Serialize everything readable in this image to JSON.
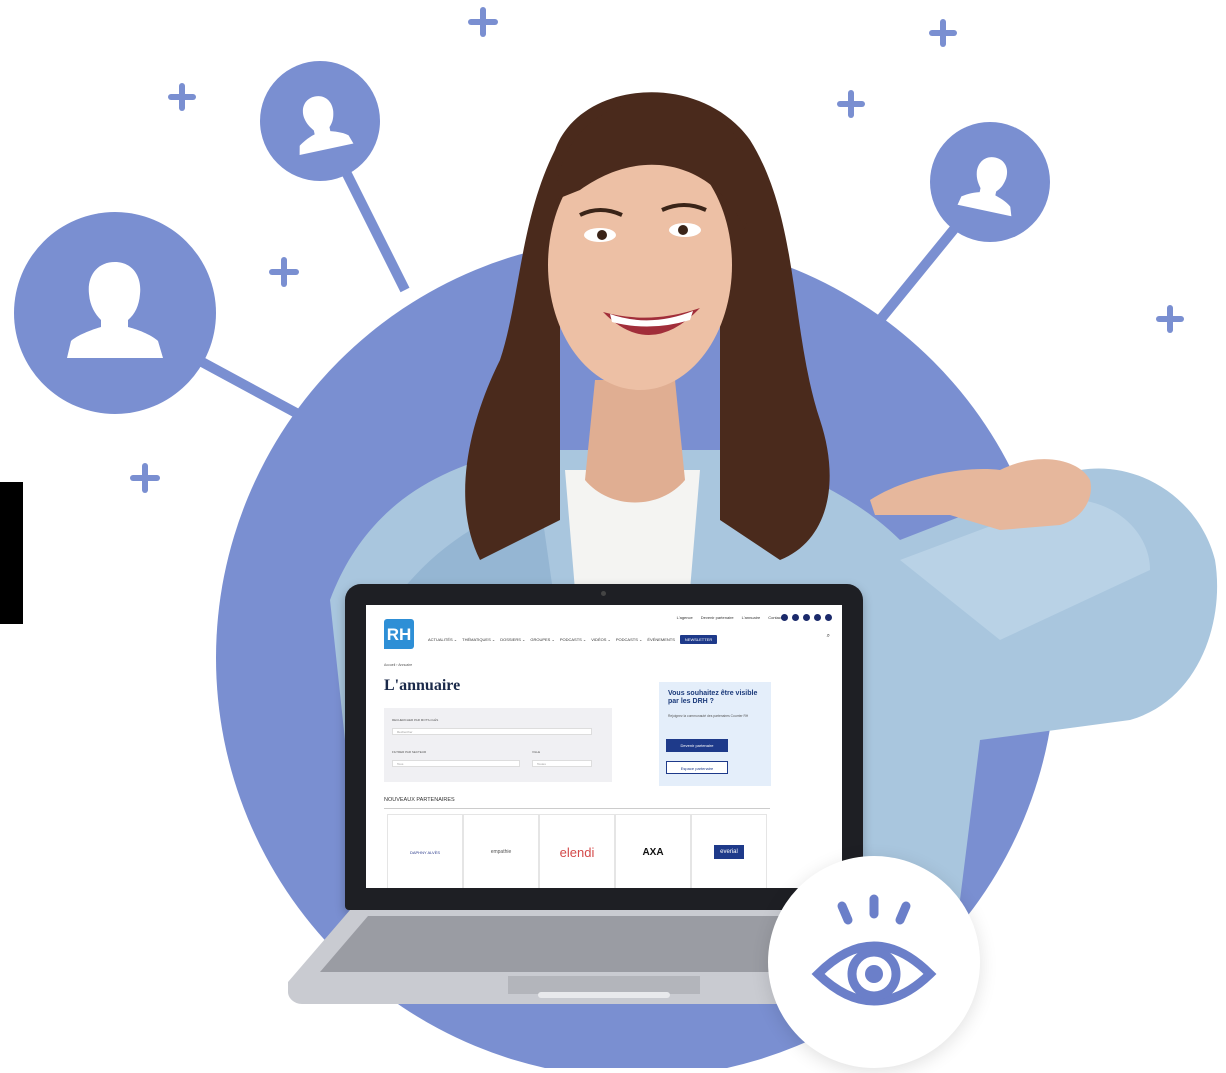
{
  "colors": {
    "accent": "#7a8fd1",
    "brand_navy": "#1e3a8a",
    "logo_blue": "#2e8fd6"
  },
  "site": {
    "logo_text": "RH",
    "utility_links": [
      "L'agence",
      "Devenir partenaire",
      "L'annuaire",
      "Contact"
    ],
    "nav_items": [
      "ACTUALITÉS ⌄",
      "THÉMATIQUES ⌄",
      "DOSSIERS ⌄",
      "GROUPES ⌄",
      "PODCASTS ⌄",
      "VIDÉOS ⌄",
      "PODCASTS ⌄",
      "ÉVÉNEMENTS"
    ],
    "newsletter_label": "NEWSLETTER",
    "breadcrumb": "Accueil › Annuaire",
    "page_title": "L'annuaire",
    "filter": {
      "keyword_label": "RECHERCHER PAR MOTS-CLÉS",
      "keyword_placeholder": "Rechercher",
      "category_label": "FILTRER PAR SECTEUR",
      "category_value": "Tous",
      "city_label": "VILLE",
      "city_value": "Toutes"
    },
    "promo": {
      "heading": "Vous souhaitez être visible par les DRH ?",
      "text": "Rejoignez la communauté des partenaires Courrier RH",
      "primary_button": "Devenir partenaire",
      "secondary_button": "Espace partenaire"
    },
    "new_partners_title": "NOUVEAUX PARTENAIRES",
    "partners": [
      "DAPHNY ALVÈS",
      "empathie",
      "elendi",
      "AXA",
      "everial"
    ]
  },
  "icons": [
    "user-icon",
    "plus-icon",
    "eye-icon"
  ]
}
